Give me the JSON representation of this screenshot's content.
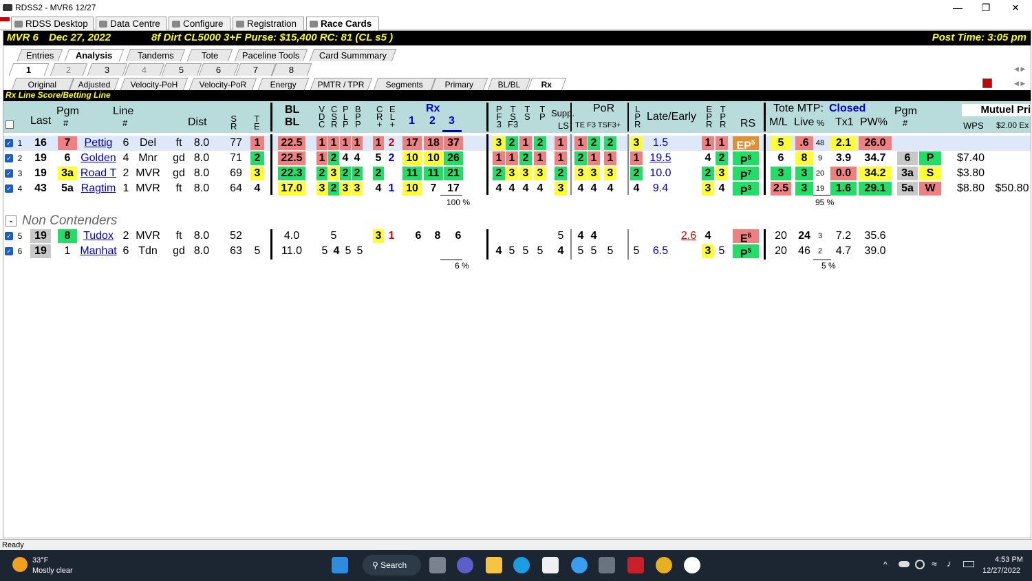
{
  "window": {
    "title": "RDSS2 - MVR6  12/27"
  },
  "top_tabs": [
    "RDSS Desktop",
    "Data Centre",
    "Configure",
    "Registration",
    "Race Cards"
  ],
  "race_info": {
    "track": "MVR  6",
    "date": "Dec 27, 2022",
    "conditions": "8f  Dirt   CL5000  3+F   Purse: $15,400   RC: 81  (CL s5 )",
    "post_time": "Post Time: 3:05 pm"
  },
  "section_tabs": [
    "Entries",
    "Analysis",
    "Tandems",
    "Tote",
    "Paceline Tools",
    "Card Summmary"
  ],
  "race_tabs": [
    "1",
    "2",
    "3",
    "4",
    "5",
    "6",
    "7",
    "8"
  ],
  "view_tabs": [
    "Original",
    "Adjusted",
    "Velocity-PoH",
    "Velocity-PoR",
    "Energy",
    "PMTR / TPR",
    "Segments",
    "Primary",
    "BL/BL",
    "Rx"
  ],
  "section_title": "Rx Line Score/Betting Line",
  "headers": {
    "last": "Last",
    "pgm": "Pgm",
    "pgm_num": "#",
    "line": "Line",
    "line_num": "#",
    "dist": "Dist",
    "sr": "S\nR",
    "te": "T\nE",
    "blbl": "BL\nBL",
    "vdc": "V\nD\nC",
    "csr": "C\nS\nR",
    "pl": "P\nL\nP",
    "bpp": "B\nP\nP",
    "cr": "C\nR\n+",
    "el": "E\nL\n+",
    "rx": "Rx",
    "rx1": "1",
    "rx2": "2",
    "rx3": "3",
    "pf3": "P\nF\n3",
    "tsf3": "T\nS\nF3",
    "ts": "T\nS",
    "tp": "T\nP",
    "supp": "Supp.",
    "ls": "LS",
    "por": "PoR",
    "por_sub": "TE F3  TSF3+",
    "lpr": "L\nP\nR",
    "late_early": "Late/Early",
    "epr": "E\nP\nR",
    "tpr": "T\nP\nR",
    "rs": "RS",
    "tote_mtp": "Tote MTP:",
    "closed": "Closed",
    "ml": "M/L",
    "live": "Live",
    "pct": "%",
    "tx1": "Tx1",
    "pw": "PW%",
    "pgm2": "Pgm",
    "pgm2_num": "#",
    "mutuel": "Mutuel Pri",
    "wps": "WPS",
    "ex": "$2.00 Ex"
  },
  "contenders": [
    {
      "n": "1",
      "last": "16",
      "pgm": "7",
      "name": "Pettig",
      "line": "6",
      "trk": "Del",
      "surf": "ft",
      "dist": "8.0",
      "sr": "77",
      "te": "1",
      "bl": "22.5",
      "vdc": "1",
      "csr": "1",
      "pl": "1",
      "bpp": "1",
      "cr": "1",
      "el": "2",
      "rx1": "17",
      "rx2": "18",
      "rx3": "37",
      "pf3": "3",
      "tsf3": "2",
      "ts": "1",
      "tp": "2",
      "ls": "1",
      "te2": "1",
      "f3": "2",
      "tsf": "2",
      "lpr": "3",
      "late": "1.5",
      "epr": "1",
      "tpr": "1",
      "rs": "EP",
      "rs_sup": "5",
      "ml": "5",
      "live": ".6",
      "pct": "48",
      "tx1": "2.1",
      "pw": "26.0",
      "pgm2": "",
      "fin": "",
      "wps": "",
      "ex": ""
    },
    {
      "n": "2",
      "last": "19",
      "pgm": "6",
      "name": "Golden",
      "line": "4",
      "trk": "Mnr",
      "surf": "gd",
      "dist": "8.0",
      "sr": "71",
      "te": "2",
      "bl": "22.5",
      "vdc": "1",
      "csr": "2",
      "pl": "4",
      "bpp": "4",
      "cr": "5",
      "el": "2",
      "rx1": "10",
      "rx2": "10",
      "rx3": "26",
      "pf3": "1",
      "tsf3": "1",
      "ts": "2",
      "tp": "1",
      "ls": "1",
      "te2": "2",
      "f3": "1",
      "tsf": "1",
      "lpr": "1",
      "late": "19.5",
      "epr": "4",
      "tpr": "2",
      "rs": "P",
      "rs_sup": "5",
      "ml": "6",
      "live": "8",
      "pct": "9",
      "tx1": "3.9",
      "pw": "34.7",
      "pgm2": "6",
      "fin": "P",
      "wps": "$7.40",
      "ex": ""
    },
    {
      "n": "3",
      "last": "19",
      "pgm": "3a",
      "name": "Road T",
      "line": "2",
      "trk": "MVR",
      "surf": "gd",
      "dist": "8.0",
      "sr": "69",
      "te": "3",
      "bl": "22.3",
      "vdc": "2",
      "csr": "3",
      "pl": "2",
      "bpp": "2",
      "cr": "2",
      "el": "",
      "rx1": "11",
      "rx2": "11",
      "rx3": "21",
      "pf3": "2",
      "tsf3": "3",
      "ts": "3",
      "tp": "3",
      "ls": "2",
      "te2": "3",
      "f3": "3",
      "tsf": "3",
      "lpr": "2",
      "late": "10.0",
      "epr": "2",
      "tpr": "3",
      "rs": "P",
      "rs_sup": "7",
      "ml": "3",
      "live": "3",
      "pct": "20",
      "tx1": "0.0",
      "pw": "34.2",
      "pgm2": "3a",
      "fin": "S",
      "wps": "$3.80",
      "ex": ""
    },
    {
      "n": "4",
      "last": "43",
      "pgm": "5a",
      "name": "Ragtim",
      "line": "1",
      "trk": "MVR",
      "surf": "ft",
      "dist": "8.0",
      "sr": "64",
      "te": "4",
      "bl": "17.0",
      "vdc": "3",
      "csr": "2",
      "pl": "3",
      "bpp": "3",
      "cr": "4",
      "el": "1",
      "rx1": "10",
      "rx2": "7",
      "rx3": "17",
      "pf3": "4",
      "tsf3": "4",
      "ts": "4",
      "tp": "4",
      "ls": "3",
      "te2": "4",
      "f3": "4",
      "tsf": "4",
      "lpr": "4",
      "late": "9.4",
      "epr": "3",
      "tpr": "4",
      "rs": "P",
      "rs_sup": "3",
      "ml": "2.5",
      "live": "3",
      "pct": "19",
      "tx1": "1.6",
      "pw": "29.1",
      "pgm2": "5a",
      "fin": "W",
      "wps": "$8.80",
      "ex": "$50.80"
    }
  ],
  "totals": {
    "rx": "100 %",
    "tote": "95 %",
    "rx_nc": "6 %",
    "tote_nc": "5 %"
  },
  "non_contenders_title": "Non Contenders",
  "non_contenders": [
    {
      "n": "5",
      "last": "19",
      "pgm": "8",
      "name": "Tudox",
      "line": "2",
      "trk": "MVR",
      "surf": "ft",
      "dist": "8.0",
      "sr": "52",
      "te": "",
      "bl": "4.0",
      "vdc": "5",
      "cr": "3",
      "el": "1",
      "rx1": "6",
      "rx2": "8",
      "rx3": "6",
      "ls": "5",
      "te2": "4",
      "f3": "4",
      "early": "2.6",
      "epr": "4",
      "rs": "E",
      "rs_sup": "6",
      "ml": "20",
      "live": "24",
      "pct": "3",
      "tx1": "7.2",
      "pw": "35.6"
    },
    {
      "n": "6",
      "last": "19",
      "pgm": "1",
      "name": "Manhat",
      "line": "6",
      "trk": "Tdn",
      "surf": "gd",
      "dist": "8.0",
      "sr": "63",
      "te": "5",
      "bl": "11.0",
      "vdc": "5",
      "csr": "4",
      "pl": "5",
      "bpp": "5",
      "pf3": "4",
      "tsf3": "5",
      "ts": "5",
      "tp": "5",
      "ls": "4",
      "te2": "5",
      "f3": "5",
      "tsf": "5",
      "lpr": "5",
      "late": "6.5",
      "epr": "3",
      "tpr": "5",
      "rs": "P",
      "rs_sup": "5",
      "ml": "20",
      "live": "46",
      "pct": "2",
      "tx1": "4.7",
      "pw": "39.0"
    }
  ],
  "status": "Ready",
  "taskbar": {
    "temp": "33°F",
    "weather": "Mostly clear",
    "search": "Search",
    "time": "4:53 PM",
    "date": "12/27/2022"
  }
}
